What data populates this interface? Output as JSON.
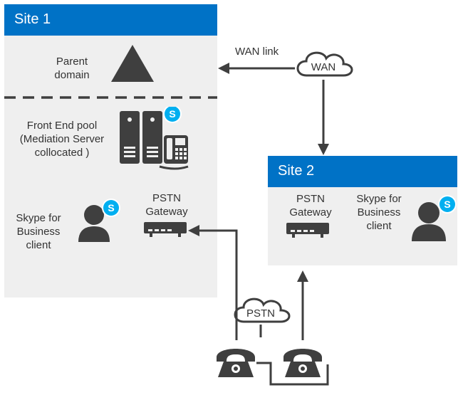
{
  "site1": {
    "title": "Site 1",
    "parent_domain": "Parent domain",
    "front_end_pool": "Front End pool (Mediation Server collocated )",
    "client_label": "Skype for Business client",
    "gateway_label": "PSTN Gateway"
  },
  "site2": {
    "title": "Site 2",
    "gateway_label": "PSTN Gateway",
    "client_label": "Skype for Business client"
  },
  "links": {
    "wan_link": "WAN link",
    "wan_cloud": "WAN",
    "pstn_cloud": "PSTN"
  }
}
